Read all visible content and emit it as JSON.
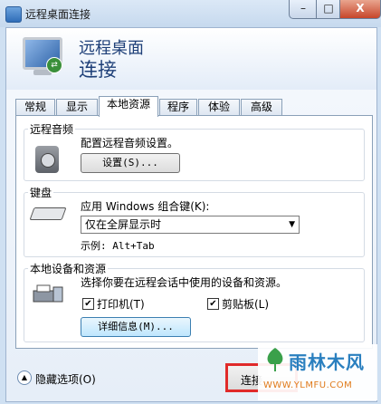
{
  "window": {
    "title": "远程桌面连接",
    "caption_minimize": "–",
    "caption_maximize": "□",
    "caption_close": "X"
  },
  "header": {
    "line1": "远程桌面",
    "line2": "连接"
  },
  "tabs": [
    {
      "label": "常规"
    },
    {
      "label": "显示"
    },
    {
      "label": "本地资源"
    },
    {
      "label": "程序"
    },
    {
      "label": "体验"
    },
    {
      "label": "高级"
    }
  ],
  "active_tab": "本地资源",
  "audio": {
    "title": "远程音频",
    "description": "配置远程音频设置。",
    "settings_button": "设置(S)..."
  },
  "keyboard": {
    "title": "键盘",
    "label": "应用 Windows 组合键(K):",
    "select_value": "仅在全屏显示时",
    "example": "示例: Alt+Tab"
  },
  "devices": {
    "title": "本地设备和资源",
    "description": "选择你要在远程会话中使用的设备和资源。",
    "printers_label": "打印机(T)",
    "printers_checked": true,
    "clipboard_label": "剪贴板(L)",
    "clipboard_checked": true,
    "details_button": "详细信息(M)..."
  },
  "footer": {
    "hide_options_label": "隐藏选项(O)",
    "connect_button": "连接"
  },
  "watermark": {
    "text": "雨林木风",
    "url": "WWW.YLMFU.COM"
  },
  "colors": {
    "highlight_border": "#e02a2a",
    "header_text": "#1e3f78"
  }
}
